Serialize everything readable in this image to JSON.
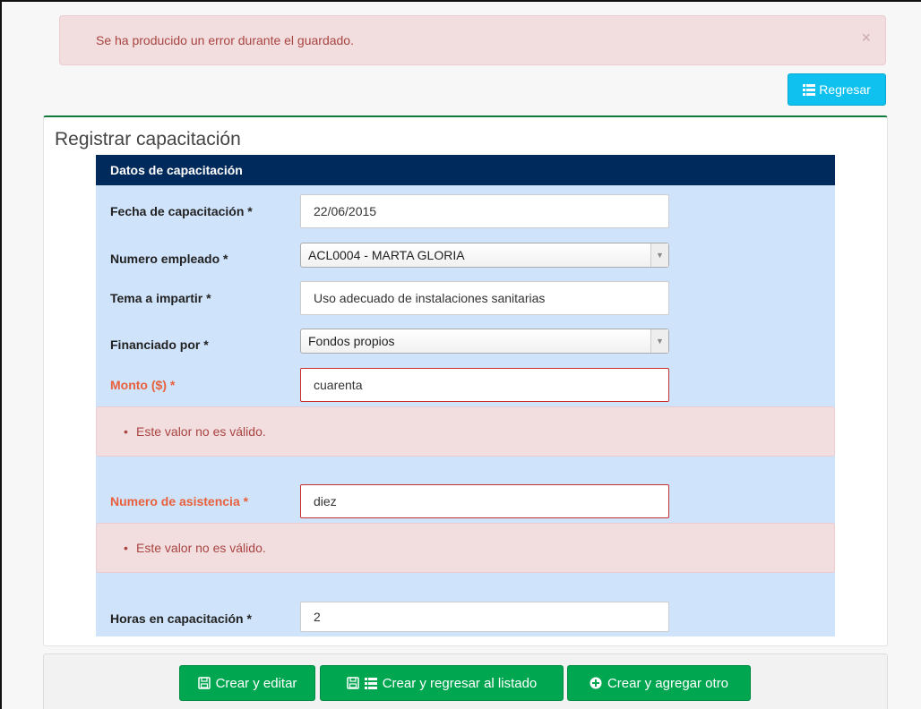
{
  "alert": {
    "message": "Se ha producido un error durante el guardado.",
    "close_glyph": "×"
  },
  "toolbar": {
    "back_label": "Regresar",
    "back_icon": "list-icon"
  },
  "panel": {
    "title": "Registrar capacitación"
  },
  "form": {
    "section_title": "Datos de capacitación",
    "fields": {
      "fecha": {
        "label": "Fecha de capacitación *",
        "value": "22/06/2015"
      },
      "empleado": {
        "label": "Numero empleado *",
        "value": "ACL0004 - MARTA GLORIA"
      },
      "tema": {
        "label": "Tema a impartir *",
        "value": "Uso adecuado de instalaciones sanitarias"
      },
      "financiado": {
        "label": "Financiado por *",
        "value": "Fondos propios"
      },
      "monto": {
        "label": "Monto ($) *",
        "value": "cuarenta",
        "error": "Este valor no es válido."
      },
      "asistencia": {
        "label": "Numero de asistencia *",
        "value": "diez",
        "error": "Este valor no es válido."
      },
      "horas": {
        "label": "Horas en capacitación *",
        "value": "2"
      }
    }
  },
  "actions": {
    "create_edit": "Crear y editar",
    "create_return": "Crear y regresar al listado",
    "create_add": "Crear y agregar otro"
  },
  "colors": {
    "form_header": "#002a5c",
    "form_bg": "#cfe3fb",
    "error_text": "#a94442",
    "error_label": "#e8603c",
    "success": "#00a650",
    "info": "#0ec1ee"
  }
}
